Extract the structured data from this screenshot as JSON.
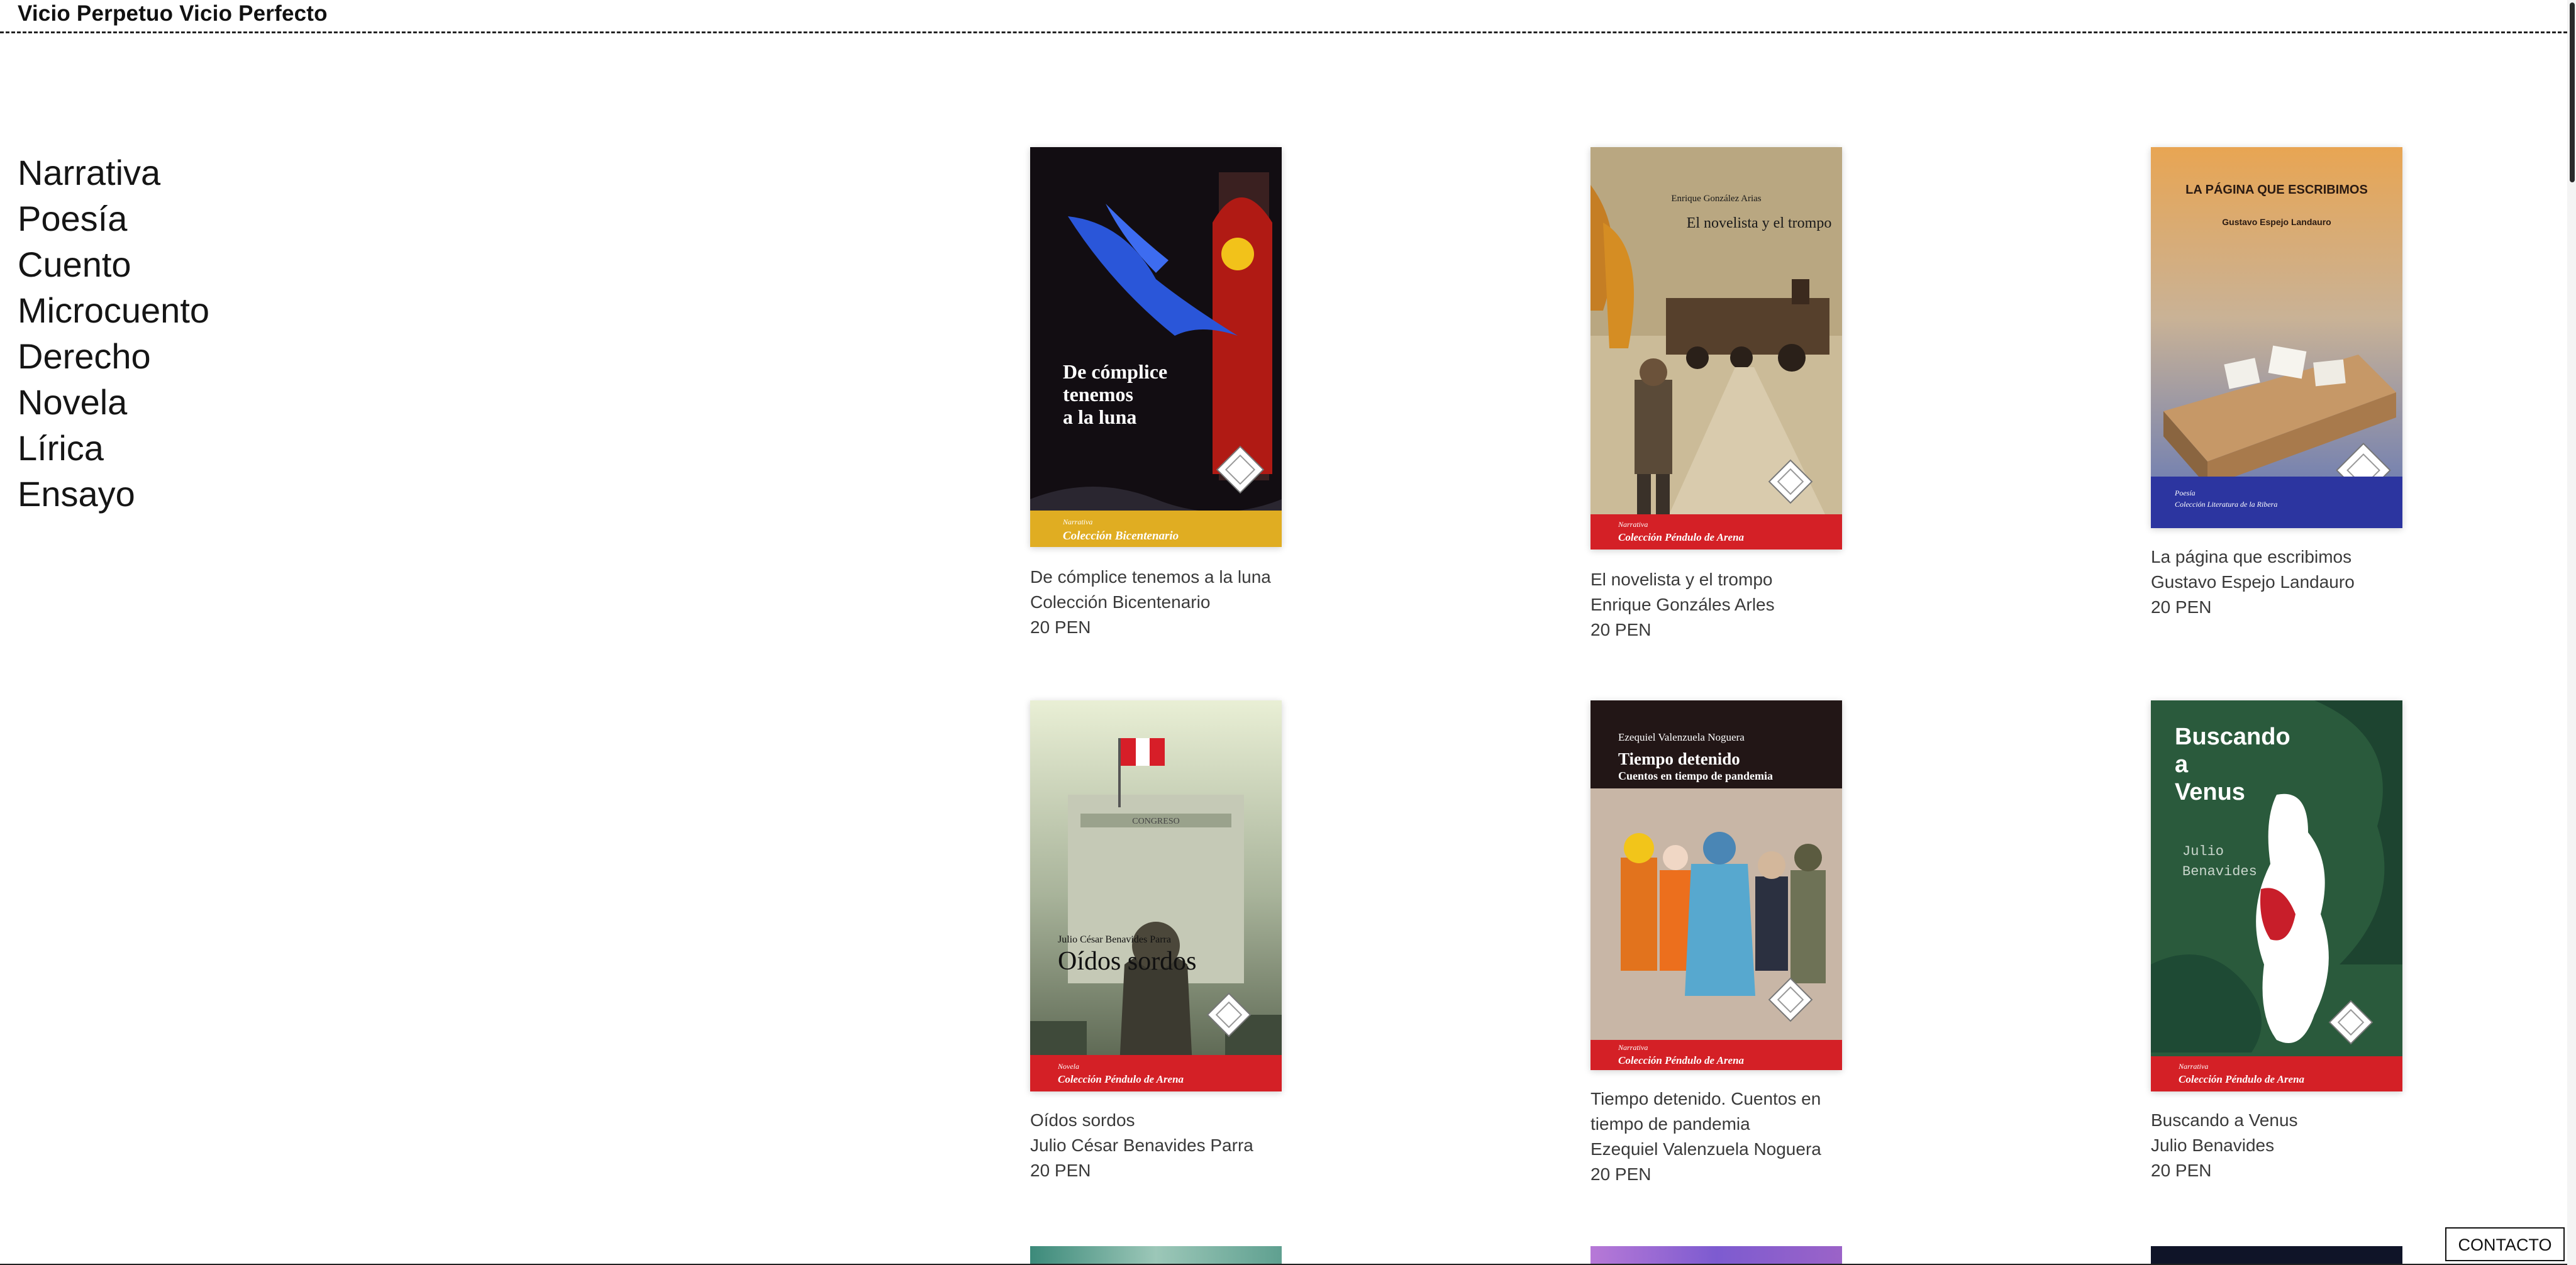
{
  "site": {
    "title": "Vicio Perpetuo Vicio Perfecto"
  },
  "categories": [
    "Narrativa",
    "Poesía",
    "Cuento",
    "Microcuento",
    "Derecho",
    "Novela",
    "Lírica",
    "Ensayo"
  ],
  "books": [
    {
      "title": "De cómplice tenemos a la luna",
      "line2": "Colección Bicentenario",
      "price": "20 PEN",
      "cover_title": [
        "De cómplice",
        "tenemos",
        "a la luna"
      ],
      "cover_band": [
        "Narrativa",
        "Colección Bicentenario"
      ]
    },
    {
      "title": "El novelista y el trompo",
      "line2": "Enrique Gonzáles Arles",
      "price": "20 PEN",
      "cover_author": "Enrique González Arias",
      "cover_title": "El novelista y el trompo",
      "cover_band": [
        "Narrativa",
        "Colección Péndulo de Arena"
      ]
    },
    {
      "title": "La página que escribimos",
      "line2": "Gustavo Espejo Landauro",
      "price": "20 PEN",
      "cover_title": "LA PÁGINA QUE ESCRIBIMOS",
      "cover_author": "Gustavo Espejo Landauro",
      "cover_band": [
        "Poesía",
        "Colección Literatura de la Ribera"
      ]
    },
    {
      "title": "Oídos sordos",
      "line2": "Julio César Benavides Parra",
      "price": "20 PEN",
      "cover_author": "Julio César Benavides Parra",
      "cover_title": "Oídos sordos",
      "cover_sign": "CONGRESO",
      "cover_band": [
        "Novela",
        "Colección Péndulo de Arena"
      ]
    },
    {
      "title": "Tiempo detenido. Cuentos en tiempo de pandemia",
      "line2": "Ezequiel Valenzuela Noguera",
      "price": "20 PEN",
      "cover_author": "Ezequiel Valenzuela Noguera",
      "cover_title": "Tiempo detenido",
      "cover_subtitle": "Cuentos en tiempo de pandemia",
      "cover_band": [
        "Narrativa",
        "Colección Péndulo de Arena"
      ]
    },
    {
      "title": "Buscando a Venus",
      "line2": "Julio Benavides",
      "price": "20 PEN",
      "cover_title": [
        "Buscando",
        "a",
        "Venus"
      ],
      "cover_author": [
        "Julio",
        "Benavides"
      ],
      "cover_band": [
        "Narrativa",
        "Colección Péndulo de Arena"
      ]
    }
  ],
  "contact": {
    "label": "CONTACTO"
  },
  "colors": {
    "band_red": "#d42026",
    "band_gold": "#e0ad22",
    "band_blue": "#2c35a0"
  }
}
